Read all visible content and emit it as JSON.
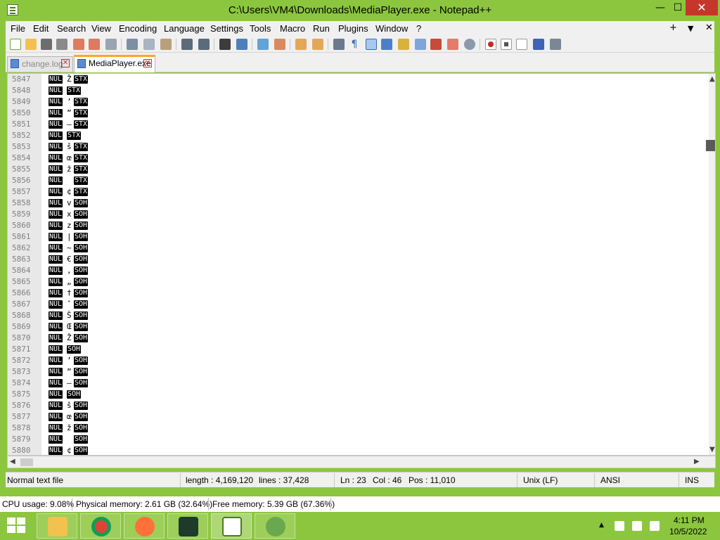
{
  "window": {
    "title": "C:\\Users\\VM4\\Downloads\\MediaPlayer.exe - Notepad++",
    "min_glyph": "—",
    "max_glyph": "☐",
    "close_glyph": "✕"
  },
  "menu": {
    "items": [
      "File",
      "Edit",
      "Search",
      "View",
      "Encoding",
      "Language",
      "Settings",
      "Tools",
      "Macro",
      "Run",
      "Plugins",
      "Window",
      "?"
    ],
    "plus": "+",
    "dropdown": "▼",
    "close": "✕"
  },
  "toolbar": {
    "icons": [
      "new-file-icon",
      "open-file-icon",
      "save-icon",
      "save-all-icon",
      "close-icon",
      "close-all-icon",
      "print-icon",
      "cut-icon",
      "copy-icon",
      "paste-icon",
      "undo-icon",
      "redo-icon",
      "find-icon",
      "replace-icon",
      "zoom-in-icon",
      "zoom-out-icon",
      "sync-vertical-icon",
      "sync-horizontal-icon",
      "word-wrap-icon",
      "show-all-chars-icon",
      "indent-guide-icon",
      "user-language-icon",
      "doc-map-icon",
      "function-list-icon",
      "folder-workspace-icon",
      "monitoring-icon",
      "record-macro-icon",
      "stop-macro-icon",
      "play-macro-icon",
      "run-macro-multiple-icon",
      "save-macro-icon"
    ]
  },
  "tabs": [
    {
      "label": "change.log",
      "active": false,
      "close": "✕"
    },
    {
      "label": "MediaPlayer.exe",
      "active": true,
      "close": "✕"
    }
  ],
  "editor": {
    "lines": [
      {
        "n": "5847",
        "a": "NUL",
        "m": "Ž",
        "b": "STX"
      },
      {
        "n": "5848",
        "a": "NUL",
        "m": "",
        "b": "STX"
      },
      {
        "n": "5849",
        "a": "NUL",
        "m": "’",
        "b": "STX"
      },
      {
        "n": "5850",
        "a": "NUL",
        "m": "”",
        "b": "STX"
      },
      {
        "n": "5851",
        "a": "NUL",
        "m": "–",
        "b": "STX"
      },
      {
        "n": "5852",
        "a": "NUL",
        "m": "",
        "b": "STX"
      },
      {
        "n": "5853",
        "a": "NUL",
        "m": "š",
        "b": "STX"
      },
      {
        "n": "5854",
        "a": "NUL",
        "m": "œ",
        "b": "STX"
      },
      {
        "n": "5855",
        "a": "NUL",
        "m": "ž",
        "b": "STX"
      },
      {
        "n": "5856",
        "a": "NUL",
        "m": " ",
        "b": "STX"
      },
      {
        "n": "5857",
        "a": "NUL",
        "m": "¢",
        "b": "STX"
      },
      {
        "n": "5858",
        "a": "NUL",
        "m": "v",
        "b": "SOH"
      },
      {
        "n": "5859",
        "a": "NUL",
        "m": "x",
        "b": "SOH"
      },
      {
        "n": "5860",
        "a": "NUL",
        "m": "z",
        "b": "SOH"
      },
      {
        "n": "5861",
        "a": "NUL",
        "m": "|",
        "b": "SOH"
      },
      {
        "n": "5862",
        "a": "NUL",
        "m": "~",
        "b": "SOH"
      },
      {
        "n": "5863",
        "a": "NUL",
        "m": "€",
        "b": "SOH"
      },
      {
        "n": "5864",
        "a": "NUL",
        "m": ",",
        "b": "SOH"
      },
      {
        "n": "5865",
        "a": "NUL",
        "m": "„",
        "b": "SOH"
      },
      {
        "n": "5866",
        "a": "NUL",
        "m": "†",
        "b": "SOH"
      },
      {
        "n": "5867",
        "a": "NUL",
        "m": "ˆ",
        "b": "SOH"
      },
      {
        "n": "5868",
        "a": "NUL",
        "m": "Š",
        "b": "SOH"
      },
      {
        "n": "5869",
        "a": "NUL",
        "m": "Œ",
        "b": "SOH"
      },
      {
        "n": "5870",
        "a": "NUL",
        "m": "Ž",
        "b": "SOH"
      },
      {
        "n": "5871",
        "a": "NUL",
        "m": "",
        "b": "SOH"
      },
      {
        "n": "5872",
        "a": "NUL",
        "m": "’",
        "b": "SOH"
      },
      {
        "n": "5873",
        "a": "NUL",
        "m": "”",
        "b": "SOH"
      },
      {
        "n": "5874",
        "a": "NUL",
        "m": "–",
        "b": "SOH"
      },
      {
        "n": "5875",
        "a": "NUL",
        "m": "",
        "b": "SOH"
      },
      {
        "n": "5876",
        "a": "NUL",
        "m": "š",
        "b": "SOH"
      },
      {
        "n": "5877",
        "a": "NUL",
        "m": "œ",
        "b": "SOH"
      },
      {
        "n": "5878",
        "a": "NUL",
        "m": "ž",
        "b": "SOH"
      },
      {
        "n": "5879",
        "a": "NUL",
        "m": " ",
        "b": "SOH"
      },
      {
        "n": "5880",
        "a": "NUL",
        "m": "¢",
        "b": "SOH"
      }
    ],
    "scroll_up": "▲",
    "scroll_down": "▼",
    "scroll_left": "◀",
    "scroll_right": "▶"
  },
  "status": {
    "file_type": "Normal text file",
    "length": "length : 4,169,120",
    "lines": "lines : 37,428",
    "ln": "Ln : 23",
    "col": "Col : 46",
    "pos": "Pos : 11,010",
    "eol": "Unix (LF)",
    "encoding": "ANSI",
    "mode": "INS"
  },
  "resources": {
    "cpu": "CPU usage: 9.08%",
    "physical": "Physical memory: 2.61 GB (32.64%)",
    "free": "Free memory: 5.39 GB (67.36%)"
  },
  "taskbar": {
    "apps": [
      "file-explorer-icon",
      "chrome-icon",
      "firefox-icon",
      "resource-monitor-icon",
      "notepad-plus-plus-icon",
      "notepad-plus-plus-gecko-icon"
    ],
    "tray_up": "▲",
    "time": "4:11 PM",
    "date": "10/5/2022"
  },
  "colors": {
    "accent": "#8cc63e",
    "tab_active_top": "#f9a825",
    "close_red": "#c7362b"
  }
}
